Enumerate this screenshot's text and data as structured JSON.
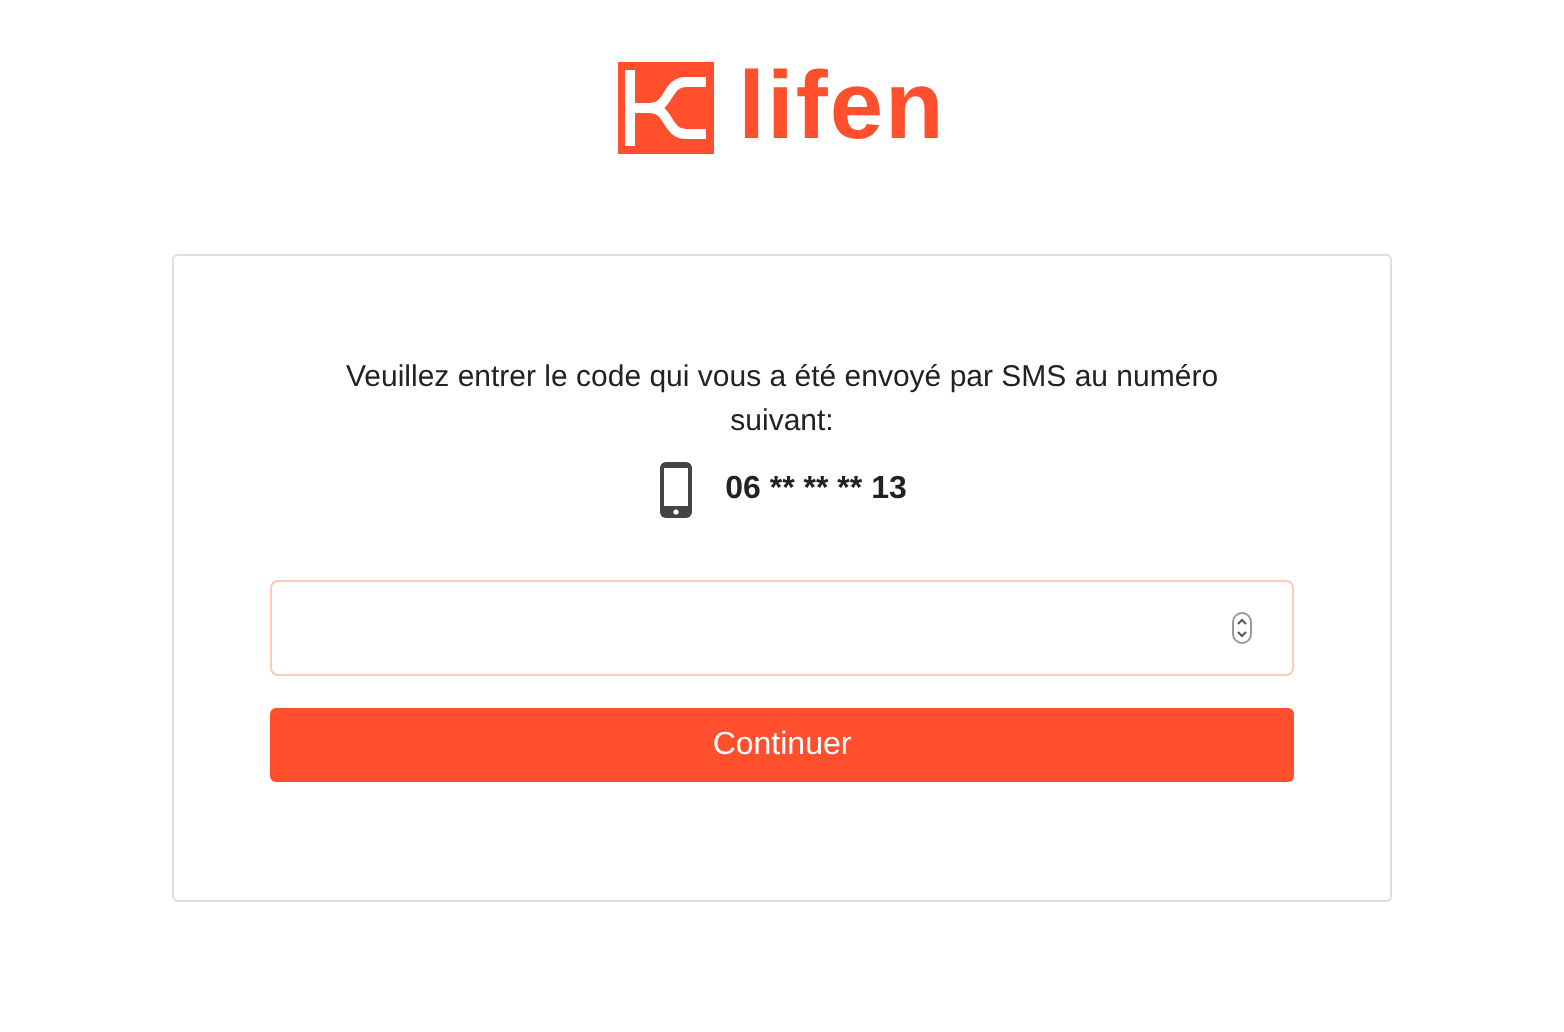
{
  "logo": {
    "text": "lifen"
  },
  "message": "Veuillez entrer le code qui vous a été envoyé par SMS au numéro suivant:",
  "phone": "06 ** ** ** 13",
  "buttons": [
    {
      "label": "Continuer"
    }
  ]
}
